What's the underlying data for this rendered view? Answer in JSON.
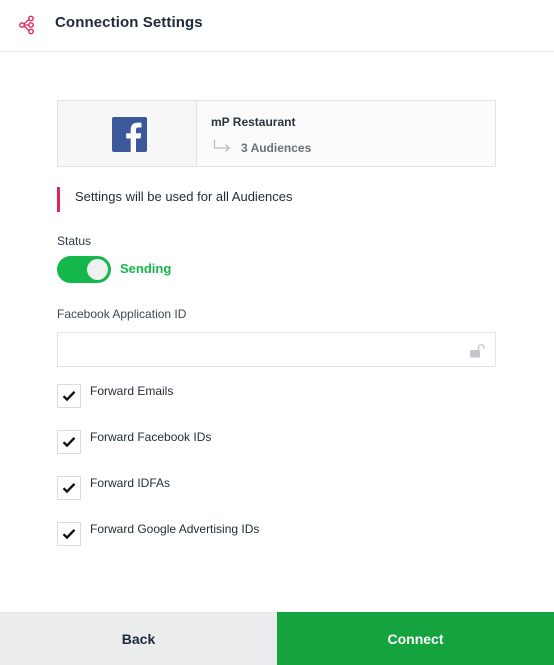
{
  "header": {
    "title": "Connection Settings",
    "icon": "connection-nodes-icon",
    "icon_color": "#e0255b"
  },
  "connector": {
    "logo": "facebook-logo",
    "name": "mP Restaurant",
    "audiences": "3 Audiences",
    "arrow_icon": "return-arrow-icon"
  },
  "notice": {
    "text": "Settings will be used for all Audiences",
    "accent": "#e0255b"
  },
  "status": {
    "label": "Status",
    "toggle_on": true,
    "value": "Sending",
    "color": "#14b84a"
  },
  "app_id": {
    "label": "Facebook Application ID",
    "value": "",
    "placeholder": "",
    "icon": "unlocked-padlock-icon"
  },
  "options": [
    {
      "label": "Forward Emails",
      "checked": true
    },
    {
      "label": "Forward Facebook IDs",
      "checked": true
    },
    {
      "label": "Forward IDFAs",
      "checked": true
    },
    {
      "label": "Forward Google Advertising IDs",
      "checked": true
    }
  ],
  "footer": {
    "back_label": "Back",
    "connect_label": "Connect",
    "connect_color": "#14a33f"
  }
}
